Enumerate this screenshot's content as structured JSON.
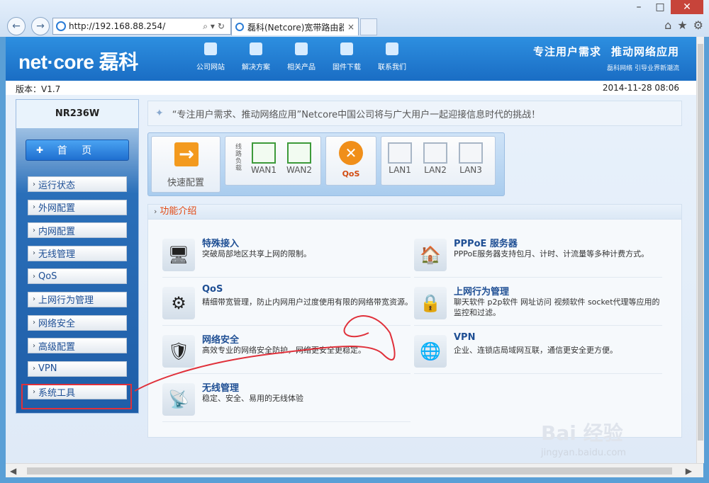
{
  "browser": {
    "address_url": "http://192.168.88.254/",
    "tab_title": "磊科(Netcore)宽带路由器...",
    "window_controls": [
      "minimize-icon",
      "maximize-icon",
      "close-icon"
    ]
  },
  "header": {
    "logo": "net·core 磊科",
    "nav": [
      {
        "label": "公司网站",
        "icon": "monitor-icon"
      },
      {
        "label": "解决方案",
        "icon": "tools-icon"
      },
      {
        "label": "相关产品",
        "icon": "router-icon"
      },
      {
        "label": "固件下载",
        "icon": "download-icon"
      },
      {
        "label": "联系我们",
        "icon": "chat-icon"
      }
    ],
    "slogan_main_1": "专注用户需求",
    "slogan_main_2": "推动网络应用",
    "slogan_sub": "磊科网络 引导业界新潮流"
  },
  "infobar": {
    "version": "版本：V1.7",
    "datetime": "2014-11-28 08:06"
  },
  "sidebar": {
    "model": "NR236W",
    "home": "首 页",
    "items": [
      "运行状态",
      "外网配置",
      "内网配置",
      "无线管理",
      "QoS",
      "上网行为管理",
      "网络安全",
      "高级配置",
      "VPN",
      "系统工具"
    ]
  },
  "quote": "“专注用户需求、推动网络应用”Netcore中国公司将与广大用户一起迎接信息时代的挑战！",
  "status": {
    "quick_label": "快速配置",
    "wan_vertical": "线路负载",
    "wan_ports": [
      "WAN1",
      "WAN2"
    ],
    "qos_label": "QoS",
    "lan_ports": [
      "LAN1",
      "LAN2",
      "LAN3"
    ]
  },
  "features": {
    "title": "功能介绍",
    "items": [
      {
        "title": "特殊接入",
        "desc": "突破局部地区共享上网的限制。",
        "icon": "monitor-icon"
      },
      {
        "title": "PPPoE 服务器",
        "desc": "PPPoE服务器支持包月、计时、计流量等多种计费方式。",
        "icon": "house-icon"
      },
      {
        "title": "QoS",
        "desc": "精细带宽管理，防止内网用户过度使用有限的网络带宽资源。",
        "icon": "gears-icon"
      },
      {
        "title": "上网行为管理",
        "desc": "聊天软件 p2p软件 网址访问 视频软件 socket代理等应用的监控和过滤。",
        "icon": "lock-folder-icon"
      },
      {
        "title": "网络安全",
        "desc": "高效专业的网络安全防护，网络更安全更稳定。",
        "icon": "shield-icon"
      },
      {
        "title": "VPN",
        "desc": "企业、连锁店局域网互联，通信更安全更方便。",
        "icon": "globe-computer-icon"
      },
      {
        "title": "无线管理",
        "desc": "稳定、安全、易用的无线体验",
        "icon": "antenna-icon"
      }
    ]
  },
  "watermark": {
    "brand": "Bai 经验",
    "site": "jingyan.baidu.com"
  },
  "colors": {
    "accent_blue": "#1a6dc4",
    "orange": "#f39a1e",
    "highlight_red": "#e0303a"
  }
}
